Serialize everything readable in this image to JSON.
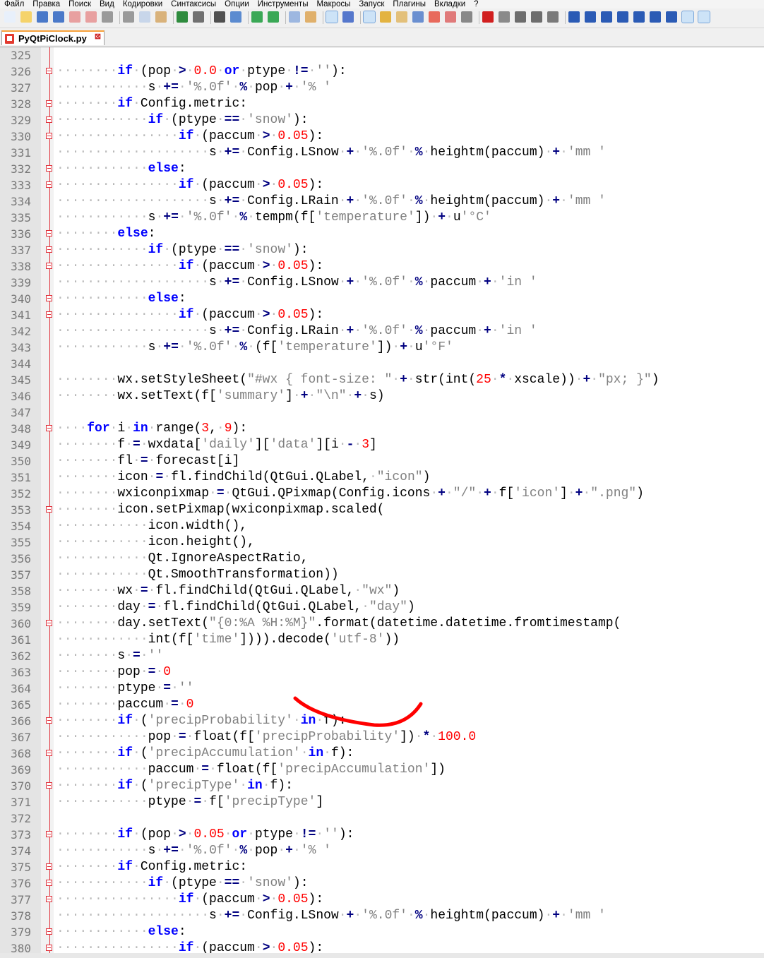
{
  "menu": [
    "Файл",
    "Правка",
    "Поиск",
    "Вид",
    "Кодировки",
    "Синтаксисы",
    "Опции",
    "Инструменты",
    "Макросы",
    "Запуск",
    "Плагины",
    "Вкладки",
    "?"
  ],
  "tab": {
    "label": "PyQtPiClock.py",
    "close_symbol": "⊠"
  },
  "annotation_color": "#ff0000",
  "lines": [
    {
      "n": "325",
      "ind": 0,
      "fold": false,
      "code": ""
    },
    {
      "n": "326",
      "ind": 2,
      "fold": true,
      "code": "if (pop > 0.0 or ptype != ''):"
    },
    {
      "n": "327",
      "ind": 3,
      "fold": false,
      "code": "s += '%.0f' % pop + '% '"
    },
    {
      "n": "328",
      "ind": 2,
      "fold": true,
      "code": "if Config.metric:"
    },
    {
      "n": "329",
      "ind": 3,
      "fold": true,
      "code": "if (ptype == 'snow'):"
    },
    {
      "n": "330",
      "ind": 4,
      "fold": true,
      "code": "if (paccum > 0.05):"
    },
    {
      "n": "331",
      "ind": 5,
      "fold": false,
      "code": "s += Config.LSnow + '%.0f' % heightm(paccum) + 'mm '"
    },
    {
      "n": "332",
      "ind": 3,
      "fold": true,
      "code": "else:"
    },
    {
      "n": "333",
      "ind": 4,
      "fold": true,
      "code": "if (paccum > 0.05):"
    },
    {
      "n": "334",
      "ind": 5,
      "fold": false,
      "code": "s += Config.LRain + '%.0f' % heightm(paccum) + 'mm '"
    },
    {
      "n": "335",
      "ind": 3,
      "fold": false,
      "code": "s += '%.0f' % tempm(f['temperature']) + u'°C'"
    },
    {
      "n": "336",
      "ind": 2,
      "fold": true,
      "code": "else:"
    },
    {
      "n": "337",
      "ind": 3,
      "fold": true,
      "code": "if (ptype == 'snow'):"
    },
    {
      "n": "338",
      "ind": 4,
      "fold": true,
      "code": "if (paccum > 0.05):"
    },
    {
      "n": "339",
      "ind": 5,
      "fold": false,
      "code": "s += Config.LSnow + '%.0f' % paccum + 'in '"
    },
    {
      "n": "340",
      "ind": 3,
      "fold": true,
      "code": "else:"
    },
    {
      "n": "341",
      "ind": 4,
      "fold": true,
      "code": "if (paccum > 0.05):"
    },
    {
      "n": "342",
      "ind": 5,
      "fold": false,
      "code": "s += Config.LRain + '%.0f' % paccum + 'in '"
    },
    {
      "n": "343",
      "ind": 3,
      "fold": false,
      "code": "s += '%.0f' % (f['temperature']) + u'°F'"
    },
    {
      "n": "344",
      "ind": 0,
      "fold": false,
      "code": ""
    },
    {
      "n": "345",
      "ind": 2,
      "fold": false,
      "code": "wx.setStyleSheet(\"#wx { font-size: \" + str(int(25 * xscale)) + \"px; }\")"
    },
    {
      "n": "346",
      "ind": 2,
      "fold": false,
      "code": "wx.setText(f['summary'] + \"\\n\" + s)"
    },
    {
      "n": "347",
      "ind": 0,
      "fold": false,
      "code": ""
    },
    {
      "n": "348",
      "ind": 1,
      "fold": true,
      "code": "for i in range(3, 9):"
    },
    {
      "n": "349",
      "ind": 2,
      "fold": false,
      "code": "f = wxdata['daily']['data'][i - 3]"
    },
    {
      "n": "350",
      "ind": 2,
      "fold": false,
      "code": "fl = forecast[i]"
    },
    {
      "n": "351",
      "ind": 2,
      "fold": false,
      "code": "icon = fl.findChild(QtGui.QLabel, \"icon\")"
    },
    {
      "n": "352",
      "ind": 2,
      "fold": false,
      "code": "wxiconpixmap = QtGui.QPixmap(Config.icons + \"/\" + f['icon'] + \".png\")"
    },
    {
      "n": "353",
      "ind": 2,
      "fold": true,
      "code": "icon.setPixmap(wxiconpixmap.scaled("
    },
    {
      "n": "354",
      "ind": 3,
      "fold": false,
      "code": "icon.width(),"
    },
    {
      "n": "355",
      "ind": 3,
      "fold": false,
      "code": "icon.height(),"
    },
    {
      "n": "356",
      "ind": 3,
      "fold": false,
      "code": "Qt.IgnoreAspectRatio,"
    },
    {
      "n": "357",
      "ind": 3,
      "fold": false,
      "code": "Qt.SmoothTransformation))"
    },
    {
      "n": "358",
      "ind": 2,
      "fold": false,
      "code": "wx = fl.findChild(QtGui.QLabel, \"wx\")"
    },
    {
      "n": "359",
      "ind": 2,
      "fold": false,
      "code": "day = fl.findChild(QtGui.QLabel, \"day\")"
    },
    {
      "n": "360",
      "ind": 2,
      "fold": true,
      "code": "day.setText(\"{0:%A %H:%M}\".format(datetime.datetime.fromtimestamp("
    },
    {
      "n": "361",
      "ind": 3,
      "fold": false,
      "code": "int(f['time']))).decode('utf-8'))"
    },
    {
      "n": "362",
      "ind": 2,
      "fold": false,
      "code": "s = ''"
    },
    {
      "n": "363",
      "ind": 2,
      "fold": false,
      "code": "pop = 0"
    },
    {
      "n": "364",
      "ind": 2,
      "fold": false,
      "code": "ptype = ''"
    },
    {
      "n": "365",
      "ind": 2,
      "fold": false,
      "code": "paccum = 0"
    },
    {
      "n": "366",
      "ind": 2,
      "fold": true,
      "code": "if ('precipProbability' in f):"
    },
    {
      "n": "367",
      "ind": 3,
      "fold": false,
      "code": "pop = float(f['precipProbability']) * 100.0"
    },
    {
      "n": "368",
      "ind": 2,
      "fold": true,
      "code": "if ('precipAccumulation' in f):"
    },
    {
      "n": "369",
      "ind": 3,
      "fold": false,
      "code": "paccum = float(f['precipAccumulation'])"
    },
    {
      "n": "370",
      "ind": 2,
      "fold": true,
      "code": "if ('precipType' in f):"
    },
    {
      "n": "371",
      "ind": 3,
      "fold": false,
      "code": "ptype = f['precipType']"
    },
    {
      "n": "372",
      "ind": 0,
      "fold": false,
      "code": ""
    },
    {
      "n": "373",
      "ind": 2,
      "fold": true,
      "code": "if (pop > 0.05 or ptype != ''):"
    },
    {
      "n": "374",
      "ind": 3,
      "fold": false,
      "code": "s += '%.0f' % pop + '% '"
    },
    {
      "n": "375",
      "ind": 2,
      "fold": true,
      "code": "if Config.metric:"
    },
    {
      "n": "376",
      "ind": 3,
      "fold": true,
      "code": "if (ptype == 'snow'):"
    },
    {
      "n": "377",
      "ind": 4,
      "fold": true,
      "code": "if (paccum > 0.05):"
    },
    {
      "n": "378",
      "ind": 5,
      "fold": false,
      "code": "s += Config.LSnow + '%.0f' % heightm(paccum) + 'mm '"
    },
    {
      "n": "379",
      "ind": 3,
      "fold": true,
      "code": "else:"
    },
    {
      "n": "380",
      "ind": 4,
      "fold": true,
      "code": "if (paccum > 0.05):"
    }
  ]
}
